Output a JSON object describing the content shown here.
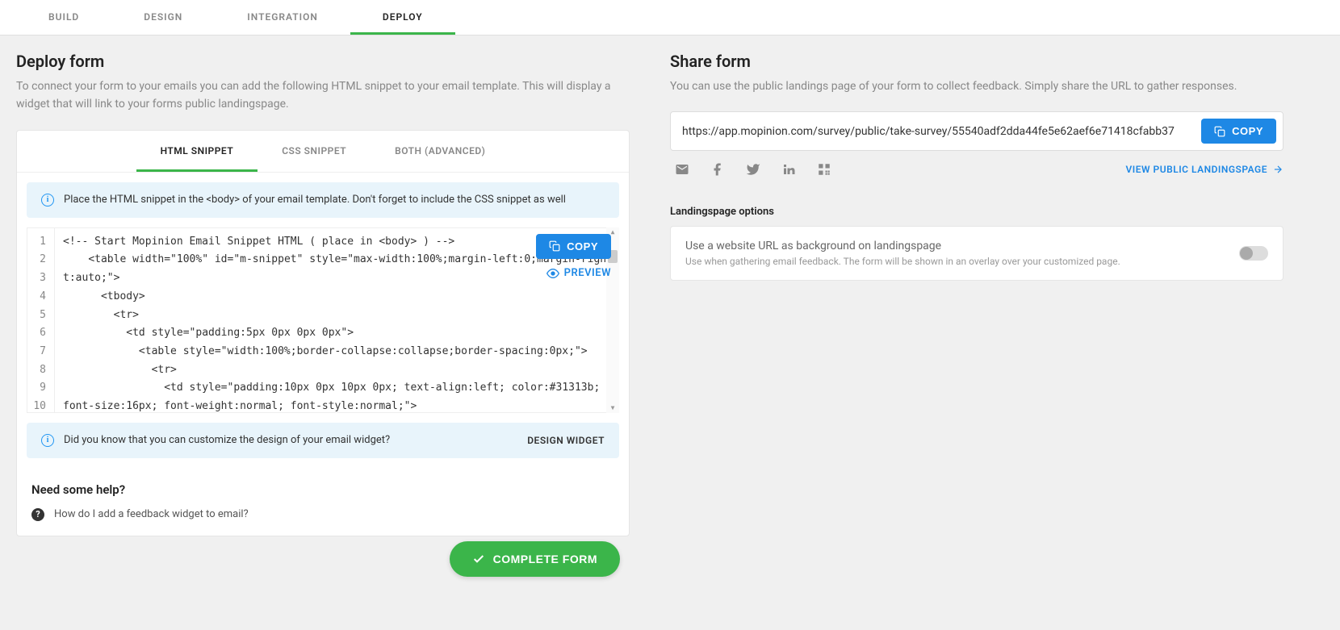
{
  "topnav": {
    "items": [
      "BUILD",
      "DESIGN",
      "INTEGRATION",
      "DEPLOY"
    ],
    "active": 3
  },
  "deploy": {
    "title": "Deploy form",
    "description": "To connect your form to your emails you can add the following HTML snippet to your email template. This will display a widget that will link to your forms public landingspage.",
    "subtabs": [
      "HTML SNIPPET",
      "CSS SNIPPET",
      "BOTH (ADVANCED)"
    ],
    "subtabs_active": 0,
    "info1": "Place the HTML snippet in the <body> of your email template. Don't forget to include the CSS snippet as well",
    "copy_button": "COPY",
    "preview_link": "PREVIEW",
    "code_lines": [
      "1",
      "2",
      "3",
      "4",
      "5",
      "6",
      "7",
      "8",
      "9",
      "10"
    ],
    "code_text": "<!-- Start Mopinion Email Snippet HTML ( place in <body> ) -->\n    <table width=\"100%\" id=\"m-snippet\" style=\"max-width:100%;margin-left:0;margin-right:auto;\">\n      <tbody>\n        <tr>\n          <td style=\"padding:5px 0px 0px 0px\">\n            <table style=\"width:100%;border-collapse:collapse;border-spacing:0px;\">\n              <tr>\n                <td style=\"padding:10px 0px 10px 0px; text-align:left; color:#31313b; font-size:16px; font-weight:normal; font-style:normal;\">",
    "info2": "Did you know that you can customize the design of your email widget?",
    "design_widget_link": "DESIGN WIDGET",
    "help_title": "Need some help?",
    "help_item1": "How do I add a feedback widget to email?",
    "complete_button": "COMPLETE FORM"
  },
  "share": {
    "title": "Share form",
    "description": "You can use the public landings page of your form to collect feedback. Simply share the URL to gather responses.",
    "url": "https://app.mopinion.com/survey/public/take-survey/55540adf2dda44fe5e62aef6e71418cfabb37",
    "copy_button": "COPY",
    "view_link": "VIEW PUBLIC LANDINGSPAGE",
    "options_title": "Landingspage options",
    "option1_label": "Use a website URL as background on landingspage",
    "option1_desc": "Use when gathering email feedback. The form will be shown in an overlay over your customized page.",
    "option1_enabled": false
  }
}
